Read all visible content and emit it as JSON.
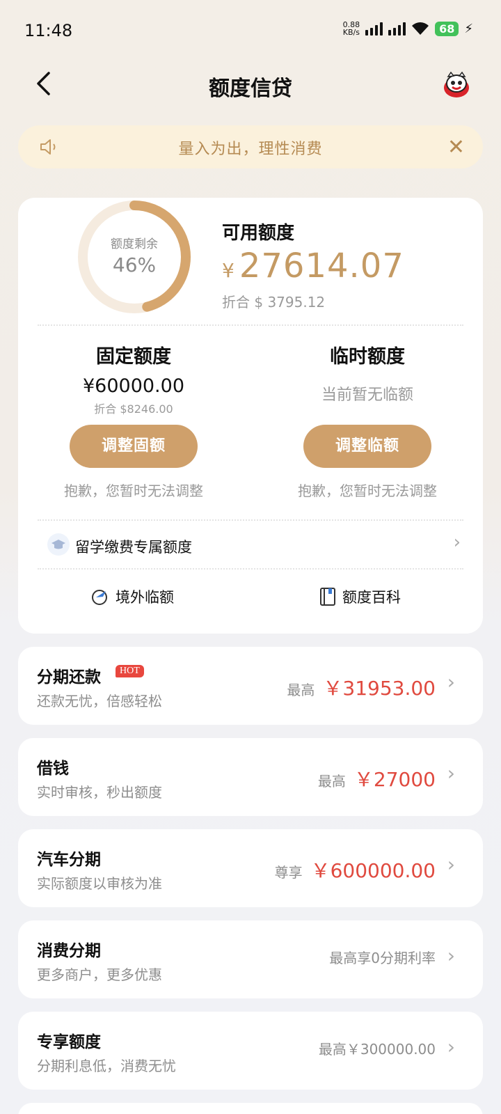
{
  "status_bar": {
    "time": "11:48",
    "net_speed_value": "0.88",
    "net_speed_unit": "KB/s",
    "battery": "68"
  },
  "header": {
    "title": "额度信贷",
    "back_icon": "chevron-left-icon",
    "mascot_icon": "mascot-avatar-icon"
  },
  "notice": {
    "text": "量入为出，理性消费",
    "speaker_icon": "speaker-icon",
    "close_icon": "close-icon"
  },
  "credit": {
    "ring_label": "额度剩余",
    "ring_value": "46%",
    "ring_fraction": 0.46,
    "available_title": "可用额度",
    "available_currency": "¥",
    "available_amount": "27614.07",
    "available_converted": "折合 $ 3795.12"
  },
  "fixed": {
    "title": "固定额度",
    "amount": "¥60000.00",
    "converted": "折合 $8246.00",
    "button": "调整固额",
    "note": "抱歉，您暂时无法调整"
  },
  "temp": {
    "title": "临时额度",
    "status": "当前暂无临额",
    "button": "调整临额",
    "note": "抱歉，您暂时无法调整"
  },
  "study": {
    "label": "留学缴费专属额度",
    "icon": "graduation-cap-icon"
  },
  "quick_links": [
    {
      "label": "境外临额",
      "icon": "plane-globe-icon"
    },
    {
      "label": "额度百科",
      "icon": "book-icon"
    }
  ],
  "products": [
    {
      "title": "分期还款",
      "badge": "HOT",
      "subtitle": "还款无忧，倍感轻松",
      "prefix": "最高",
      "amount": "￥31953.00"
    },
    {
      "title": "借钱",
      "subtitle": "实时审核，秒出额度",
      "prefix": "最高",
      "amount": "￥27000"
    },
    {
      "title": "汽车分期",
      "subtitle": "实际额度以审核为准",
      "prefix": "尊享",
      "amount": "￥600000.00"
    },
    {
      "title": "消费分期",
      "subtitle": "更多商户，更多优惠",
      "plain": "最高享0分期利率"
    },
    {
      "title": "专享额度",
      "subtitle": "分期利息低，消费无忧",
      "plain": "最高￥300000.00"
    }
  ],
  "colors": {
    "accent": "#c49a63",
    "button": "#cfa06b",
    "amount_red": "#e04a3f",
    "notice_bg": "#fbf1dc"
  }
}
